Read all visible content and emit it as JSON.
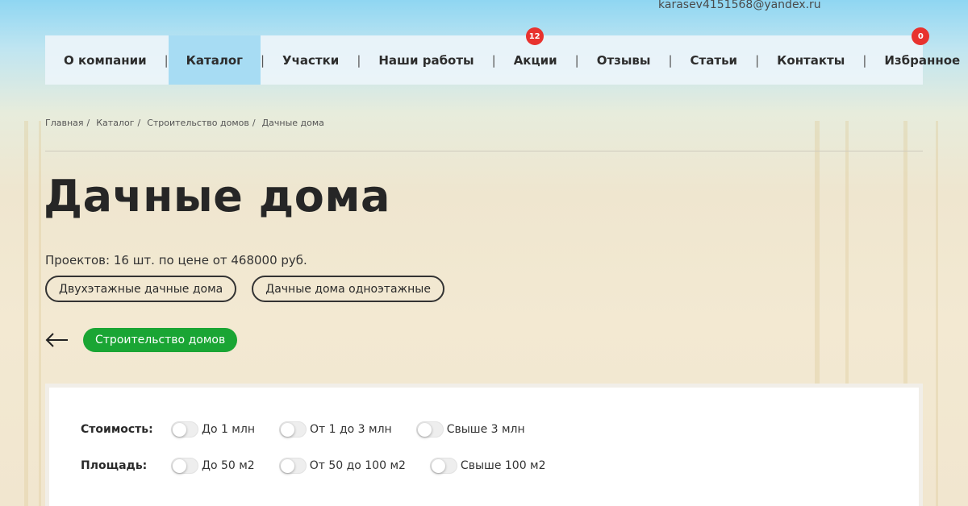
{
  "header": {
    "email": "karasev4151568@yandex.ru"
  },
  "nav": {
    "items": [
      {
        "label": "О компании"
      },
      {
        "label": "Каталог"
      },
      {
        "label": "Участки"
      },
      {
        "label": "Наши работы"
      },
      {
        "label": "Акции",
        "badge": "12"
      },
      {
        "label": "Отзывы"
      },
      {
        "label": "Статьи"
      },
      {
        "label": "Контакты"
      },
      {
        "label": "Избранное",
        "badge": "0"
      }
    ],
    "separator": "|",
    "active_color": "#a7dcf3",
    "badge_color": "#e8322e"
  },
  "breadcrumb": {
    "items": [
      "Главная",
      "Каталог",
      "Строительство домов",
      "Дачные дома"
    ],
    "separator": "/"
  },
  "page": {
    "title": "Дачные дома",
    "summary": "Проектов: 16 шт. по цене от 468000 руб."
  },
  "subcategories": [
    "Двухэтажные дачные дома",
    "Дачные дома одноэтажные"
  ],
  "parent_category": {
    "label": "Строительство домов",
    "color": "#1aa534",
    "icon": "arrow-left-icon"
  },
  "filters": {
    "cost": {
      "label": "Стоимость:",
      "options": [
        "До 1 млн",
        "От 1 до 3 млн",
        "Свыше 3 млн"
      ]
    },
    "area": {
      "label": "Площадь:",
      "options": [
        "До 50 м2",
        "От 50 до 100 м2",
        "Свыше 100 м2"
      ]
    }
  }
}
